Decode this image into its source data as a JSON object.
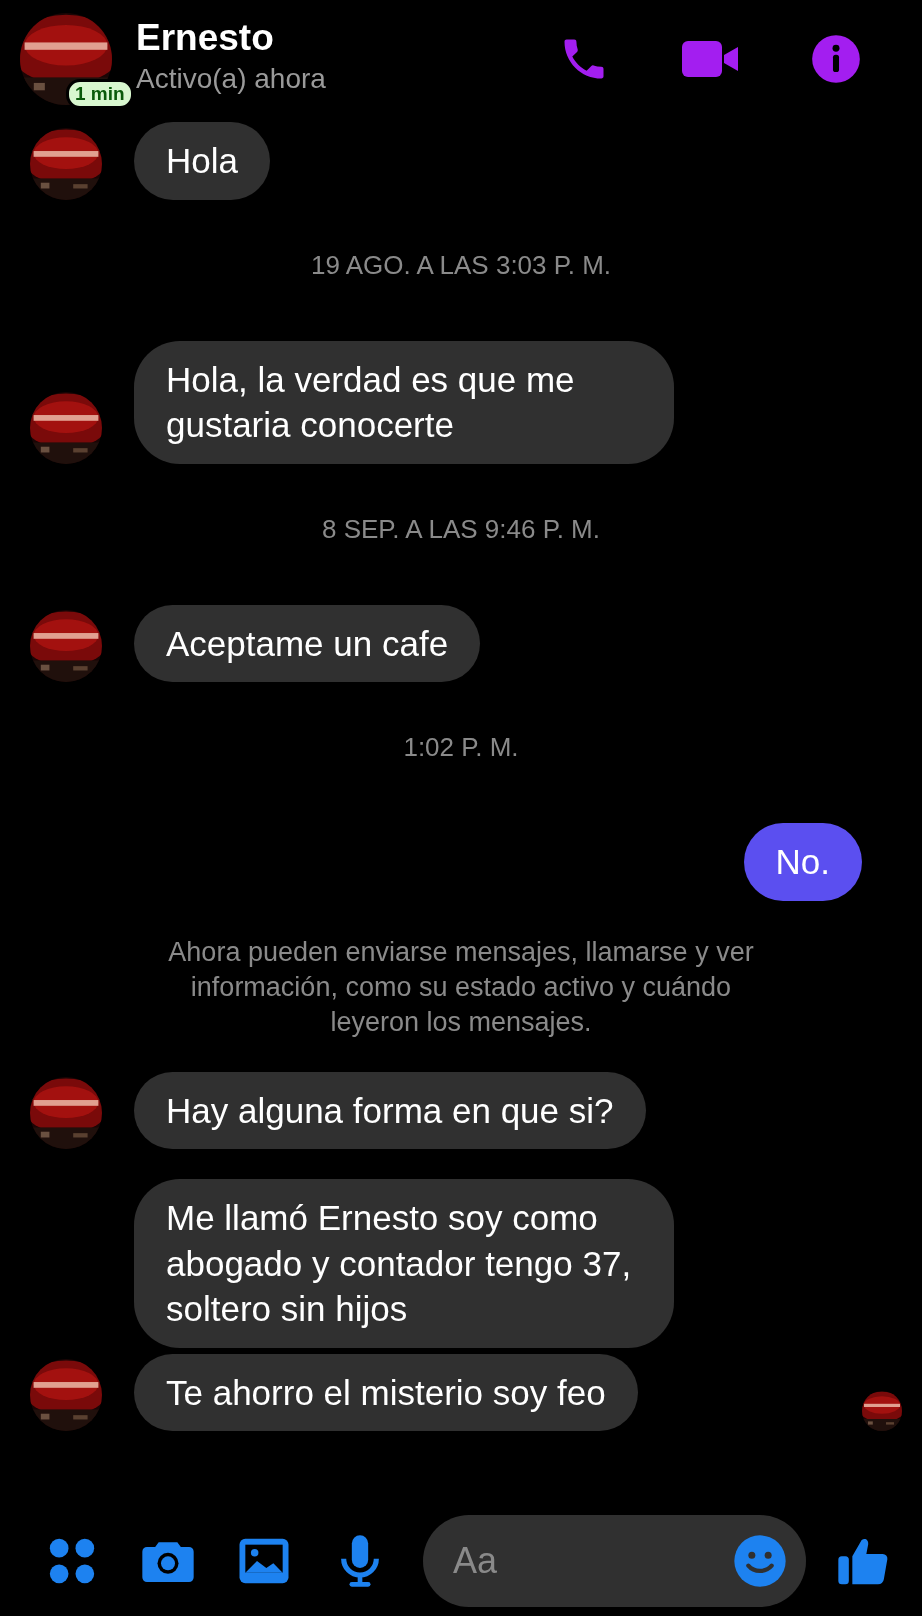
{
  "header": {
    "name": "Ernesto",
    "status": "Activo(a) ahora",
    "active_badge": "1 min"
  },
  "messages": [
    {
      "kind": "incoming",
      "text": "Hola",
      "avatar": true
    },
    {
      "kind": "timestamp",
      "text": "19 AGO. A LAS 3:03 P. M."
    },
    {
      "kind": "incoming",
      "text": "Hola, la verdad es que me gustaria conocerte",
      "avatar": true
    },
    {
      "kind": "timestamp",
      "text": "8 SEP. A LAS 9:46 P. M."
    },
    {
      "kind": "incoming",
      "text": "Aceptame un cafe",
      "avatar": true
    },
    {
      "kind": "timestamp",
      "text": "1:02 P. M."
    },
    {
      "kind": "outgoing",
      "text": "No."
    },
    {
      "kind": "notice",
      "text": "Ahora pueden enviarse mensajes, llamarse y ver información, como su estado activo y cuándo leyeron los mensajes."
    },
    {
      "kind": "incoming",
      "text": "Hay alguna forma en que si?",
      "avatar": true
    },
    {
      "kind": "incoming",
      "text": "Me llamó Ernesto soy como abogado y contador tengo 37, soltero sin hijos",
      "avatar": false
    },
    {
      "kind": "incoming",
      "text": "Te ahorro el misterio soy feo",
      "avatar": true,
      "seen": true
    }
  ],
  "composer": {
    "placeholder": "Aa"
  }
}
